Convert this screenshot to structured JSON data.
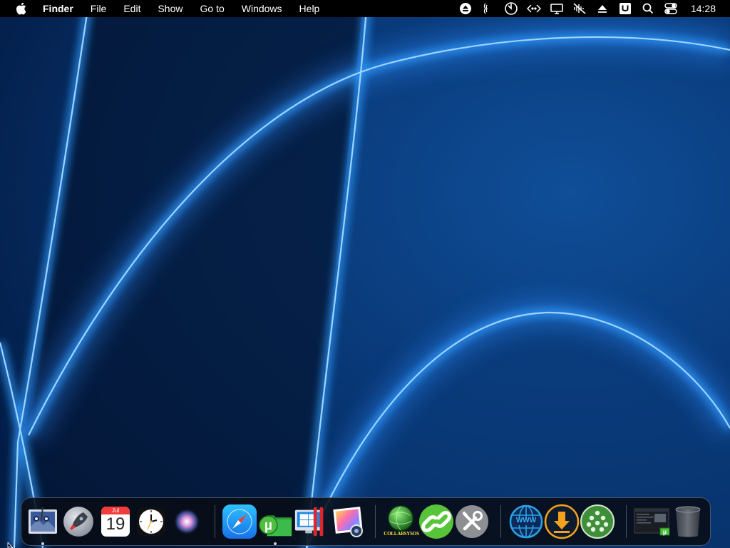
{
  "menubar": {
    "apple_icon": "apple-logo-icon",
    "app_name": "Finder",
    "menus": [
      "File",
      "Edit",
      "Show",
      "Go to",
      "Windows",
      "Help"
    ],
    "status_icons": [
      "eject-icon",
      "touch-icon",
      "power-timer-icon",
      "code-icon",
      "display-icon",
      "audio-off-icon",
      "upload-icon",
      "ubar-icon",
      "search-icon",
      "control-center-icon"
    ],
    "clock": "14:28"
  },
  "dock": {
    "items": [
      {
        "name": "preview-app",
        "icon": "preview-icon",
        "running": true
      },
      {
        "name": "launchpad",
        "icon": "rocket-icon",
        "running": false
      },
      {
        "name": "calendar",
        "icon": "calendar-icon",
        "month": "Jul",
        "day": "19",
        "running": false
      },
      {
        "name": "clock",
        "icon": "clock-icon",
        "running": false
      },
      {
        "name": "siri",
        "icon": "siri-icon",
        "running": false
      },
      {
        "name": "safari",
        "icon": "compass-icon",
        "running": false
      },
      {
        "name": "utorrent",
        "icon": "utorrent-folder-icon",
        "running": true
      },
      {
        "name": "parallels",
        "icon": "parallels-icon",
        "running": false
      },
      {
        "name": "image-capture",
        "icon": "photo-icon",
        "running": false
      },
      {
        "name": "collabsysos",
        "icon": "collab-globe-icon",
        "label": "COLLABSYSOS",
        "running": false
      },
      {
        "name": "link-app",
        "icon": "chain-link-icon",
        "running": false
      },
      {
        "name": "utilities",
        "icon": "tools-icon",
        "running": false
      },
      {
        "name": "www-app",
        "icon": "www-globe-icon",
        "label": "WWW",
        "running": false
      },
      {
        "name": "downloader",
        "icon": "download-arrow-icon",
        "running": false
      },
      {
        "name": "network-app",
        "icon": "people-network-icon",
        "running": false
      },
      {
        "name": "recent-window",
        "icon": "window-thumbnail-icon",
        "running": false
      },
      {
        "name": "trash",
        "icon": "trash-icon",
        "running": false
      }
    ]
  },
  "colors": {
    "menubar_bg": "#000000",
    "wallpaper_deep": "#021a3f",
    "wallpaper_glow": "#3aa6ff",
    "dock_bg": "#080c16"
  }
}
